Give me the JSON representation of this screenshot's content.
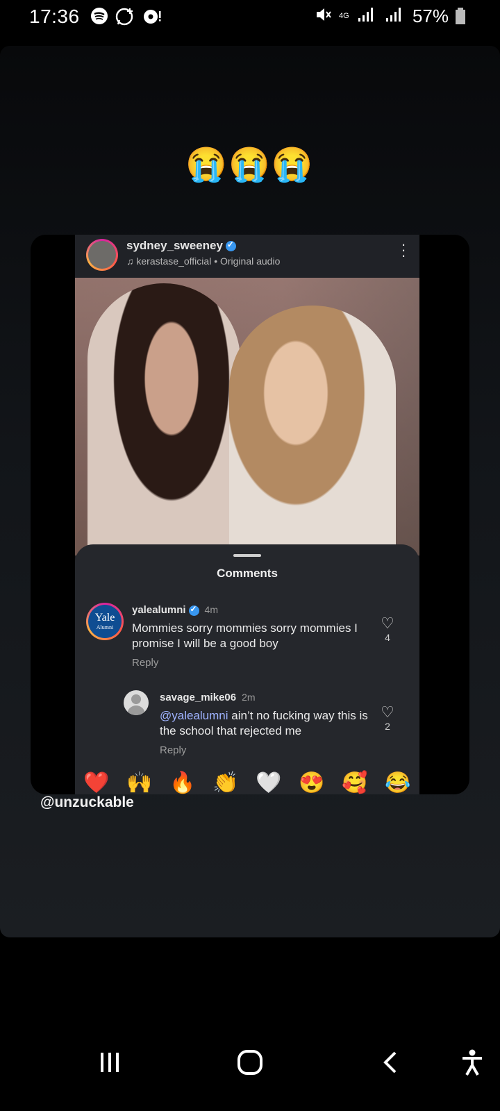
{
  "status_bar": {
    "time": "17:36",
    "network": "4G",
    "battery": "57%"
  },
  "story": {
    "emoji_caption": "😭😭😭",
    "credit": "@unzuckable"
  },
  "post": {
    "username": "sydney_sweeney",
    "audio": "kerastase_official • Original audio"
  },
  "comments_panel": {
    "title": "Comments",
    "items": [
      {
        "user": "yalealumni",
        "time": "4m",
        "text": "Mommies sorry mommies sorry mommies I promise I will be a good boy",
        "likes": "4",
        "reply_label": "Reply",
        "avatar_text_1": "Yale",
        "avatar_text_2": "Alumni"
      },
      {
        "user": "savage_mike06",
        "time": "2m",
        "mention": "@yalealumni",
        "text": " ain’t no fucking way this is the school that rejected me",
        "likes": "2",
        "reply_label": "Reply"
      }
    ],
    "reactions": [
      "❤️",
      "🙌",
      "🔥",
      "👏",
      "🤍",
      "😍",
      "🥰",
      "😂"
    ]
  },
  "colors": {
    "background": "#000000",
    "card": "#1b1e22",
    "comments_bg": "#25272c",
    "mention": "#9fb3ff",
    "verified": "#3897f0"
  }
}
